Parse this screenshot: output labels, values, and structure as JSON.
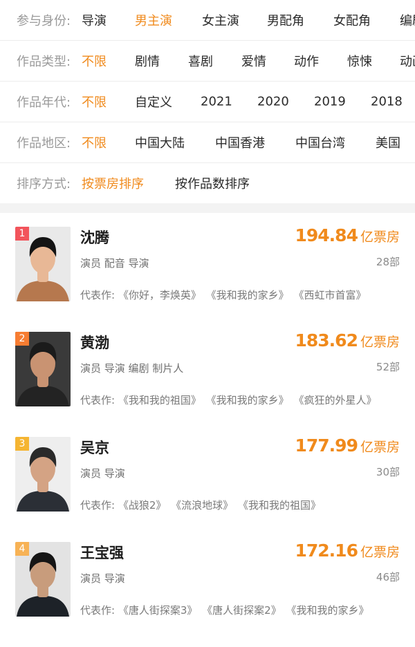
{
  "filters": [
    {
      "label": "参与身份:",
      "options": [
        "导演",
        "男主演",
        "女主演",
        "男配角",
        "女配角",
        "编剧"
      ],
      "active": 1
    },
    {
      "label": "作品类型:",
      "options": [
        "不限",
        "剧情",
        "喜剧",
        "爱情",
        "动作",
        "惊悚",
        "动画"
      ],
      "active": 0
    },
    {
      "label": "作品年代:",
      "options": [
        "不限",
        "自定义",
        "2021",
        "2020",
        "2019",
        "2018"
      ],
      "active": 0
    },
    {
      "label": "作品地区:",
      "options": [
        "不限",
        "中国大陆",
        "中国香港",
        "中国台湾",
        "美国"
      ],
      "active": 0
    },
    {
      "label": "排序方式:",
      "options": [
        "按票房排序",
        "按作品数排序"
      ],
      "active": 0
    }
  ],
  "unit": "亿票房",
  "works_label": "代表作:",
  "people": [
    {
      "rank": "1",
      "name": "沈腾",
      "roles": "演员 配音 导演",
      "box": "194.84",
      "count": "28部",
      "works": [
        "《你好，李焕英》",
        "《我和我的家乡》",
        "《西虹市首富》"
      ],
      "rank_color": "#f2545b",
      "skin": "#e8b896",
      "hair": "#141414",
      "cloth": "#b6784e",
      "bg": "#e9e9e9"
    },
    {
      "rank": "2",
      "name": "黄渤",
      "roles": "演员 导演 编剧 制片人",
      "box": "183.62",
      "count": "52部",
      "works": [
        "《我和我的祖国》",
        "《我和我的家乡》",
        "《疯狂的外星人》"
      ],
      "rank_color": "#f77d32",
      "skin": "#c99372",
      "hair": "#1b1b1b",
      "cloth": "#232323",
      "bg": "#3a3a3a"
    },
    {
      "rank": "3",
      "name": "吴京",
      "roles": "演员 导演",
      "box": "177.99",
      "count": "30部",
      "works": [
        "《战狼2》",
        "《流浪地球》",
        "《我和我的祖国》"
      ],
      "rank_color": "#f5b532",
      "skin": "#d4a384",
      "hair": "#2a2a2a",
      "cloth": "#2b2f36",
      "bg": "#eeeeee"
    },
    {
      "rank": "4",
      "name": "王宝强",
      "roles": "演员 导演",
      "box": "172.16",
      "count": "46部",
      "works": [
        "《唐人街探案3》",
        "《唐人街探案2》",
        "《我和我的家乡》"
      ],
      "rank_color": "#f7b255",
      "skin": "#c89c7c",
      "hair": "#151515",
      "cloth": "#1d2228",
      "bg": "#e3e3e3"
    }
  ]
}
